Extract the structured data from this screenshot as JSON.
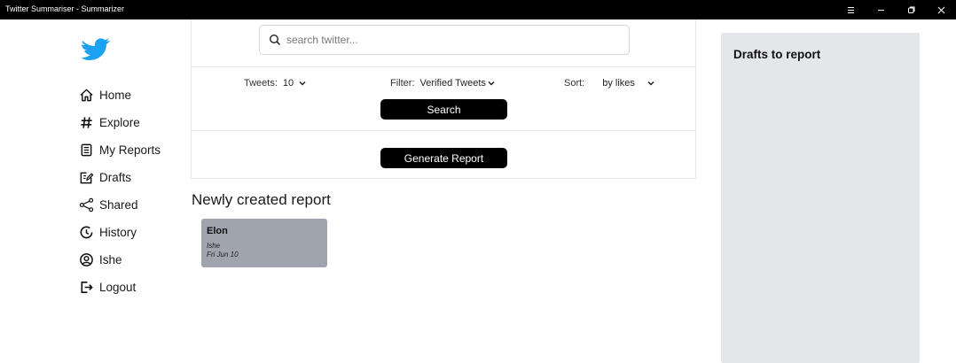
{
  "window": {
    "title": "Twitter Summariser - Summarizer",
    "controls": [
      "menu",
      "minimize",
      "restore",
      "close"
    ]
  },
  "sidebar": {
    "logo_icon": "twitter-bird-icon",
    "brand_color": "#1da1f2",
    "items": [
      {
        "label": "Home",
        "icon": "home-icon"
      },
      {
        "label": "Explore",
        "icon": "hash-icon"
      },
      {
        "label": "My Reports",
        "icon": "document-icon"
      },
      {
        "label": "Drafts",
        "icon": "edit-icon"
      },
      {
        "label": "Shared",
        "icon": "share-icon"
      },
      {
        "label": "History",
        "icon": "history-icon"
      },
      {
        "label": "Ishe",
        "icon": "user-circle-icon"
      },
      {
        "label": "Logout",
        "icon": "logout-icon"
      }
    ]
  },
  "search": {
    "placeholder": "search twitter...",
    "value": ""
  },
  "options": {
    "tweets_label": "Tweets:",
    "tweets_value": "10",
    "filter_label": "Filter:",
    "filter_value": "Verified Tweets",
    "sort_label": "Sort:",
    "sort_value": "by likes"
  },
  "buttons": {
    "search_label": "Search",
    "generate_label": "Generate Report"
  },
  "reports": {
    "section_title": "Newly created report",
    "card_color": "#9fa4ae",
    "items": [
      {
        "title": "Elon",
        "author": "Ishe",
        "date": "Fri Jun 10"
      }
    ]
  },
  "drafts": {
    "title": "Drafts to report",
    "panel_color": "#e5e6e9"
  }
}
